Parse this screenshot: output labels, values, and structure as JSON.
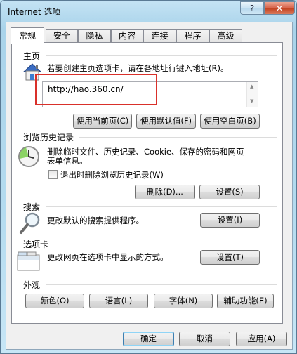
{
  "window": {
    "title": "Internet 选项",
    "help": "?",
    "close": "✕"
  },
  "tabs": [
    "常规",
    "安全",
    "隐私",
    "内容",
    "连接",
    "程序",
    "高级"
  ],
  "homepage": {
    "label": "主页",
    "description": "若要创建主页选项卡，请在各地址行键入地址(R)。",
    "url": "http://hao.360.cn/",
    "buttons": [
      "使用当前页(C)",
      "使用默认值(F)",
      "使用空白页(B)"
    ]
  },
  "history": {
    "label": "浏览历史记录",
    "description_line1": "删除临时文件、历史记录、Cookie、保存的密码和网页",
    "description_line2": "表单信息。",
    "checkbox_label": "退出时删除浏览历史记录(W)",
    "checkbox_checked": false,
    "delete_button": "删除(D)...",
    "settings_button": "设置(S)"
  },
  "search": {
    "label": "搜索",
    "description": "更改默认的搜索提供程序。",
    "settings_button": "设置(I)"
  },
  "tabs_section": {
    "label": "选项卡",
    "description": "更改网页在选项卡中显示的方式。",
    "settings_button": "设置(T)"
  },
  "appearance": {
    "label": "外观",
    "buttons": [
      "颜色(O)",
      "语言(L)",
      "字体(N)",
      "辅助功能(E)"
    ]
  },
  "footer": {
    "ok": "确定",
    "cancel": "取消",
    "apply": "应用(A)"
  },
  "colors": {
    "highlight_box": "#d9302a",
    "close_button": "#c2401f"
  }
}
